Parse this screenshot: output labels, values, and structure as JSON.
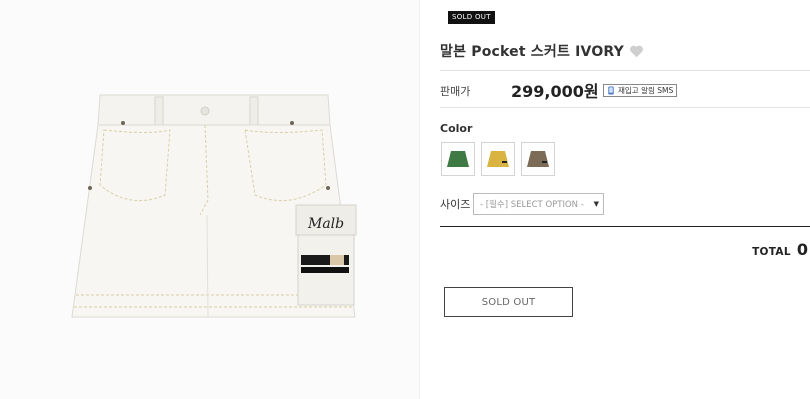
{
  "product": {
    "badge": "SOLD OUT",
    "title": "말본 Pocket 스커트 IVORY",
    "price_label": "판매가",
    "price_value": "299,000원",
    "restock_label": "재입고 알림 SMS",
    "color_label": "Color",
    "colors": [
      {
        "name": "green",
        "hex": "#3f7a45"
      },
      {
        "name": "yellow",
        "hex": "#d9b441"
      },
      {
        "name": "brown",
        "hex": "#7c6b56"
      }
    ],
    "size_label": "사이즈",
    "size_select_value": "- [필수] SELECT OPTION -",
    "total_label": "TOTAL",
    "total_value": "0",
    "soldout_button": "SOLD OUT"
  },
  "image": {
    "logo_text": "Malb"
  },
  "icons": {
    "wish": "heart-icon",
    "restock": "phone-icon",
    "caret": "caret-down-icon"
  }
}
